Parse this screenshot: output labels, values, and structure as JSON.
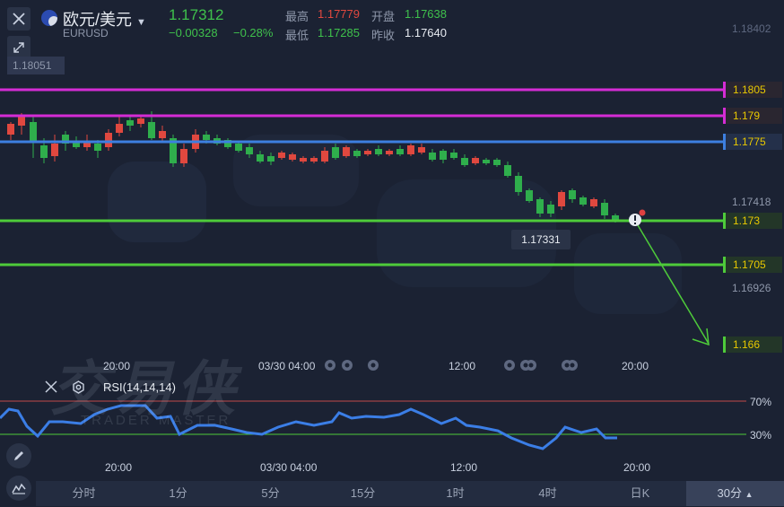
{
  "header": {
    "pair_name": "欧元/美元",
    "symbol": "EURUSD",
    "last_price": "1.17312",
    "change": "−0.00328",
    "change_pct": "−0.28%",
    "high_label": "最高",
    "high_value": "1.17779",
    "low_label": "最低",
    "low_value": "1.17285",
    "open_label": "开盘",
    "open_value": "1.17638",
    "prev_close_label": "昨收",
    "prev_close_value": "1.17640"
  },
  "price_axis": {
    "top_label": "1.18402",
    "mid_label_1": "1.17418",
    "mid_label_2": "1.16926",
    "crosshair_left": "1.18051",
    "last_tooltip": "1.17331"
  },
  "price_lines": [
    {
      "price": "1.1805",
      "color": "#d52cd5"
    },
    {
      "price": "1.179",
      "color": "#d52cd5"
    },
    {
      "price": "1.1775",
      "color": "#3d7fe0"
    },
    {
      "price": "1.173",
      "color": "#4ecb3a"
    },
    {
      "price": "1.1705",
      "color": "#4ecb3a"
    },
    {
      "price": "1.166",
      "color": "#4ecb3a"
    }
  ],
  "time_axis_top": [
    "20:00",
    "03/30 04:00",
    "12:00",
    "20:00"
  ],
  "time_axis_bottom": [
    "20:00",
    "03/30 04:00",
    "12:00",
    "20:00"
  ],
  "rsi": {
    "title": "RSI(14,14,14)",
    "upper": "70%",
    "lower": "30%"
  },
  "watermark": {
    "main": "交易侠",
    "sub": "TRADER MASTER"
  },
  "timeframes": [
    "分时",
    "1分",
    "5分",
    "15分",
    "1时",
    "4时",
    "日K",
    "30分"
  ],
  "colors": {
    "up": "#e0483f",
    "down": "#2fae4c",
    "rsi": "#3b7ee6",
    "accent_price": "#e8c800",
    "background": "#1b2233"
  }
}
